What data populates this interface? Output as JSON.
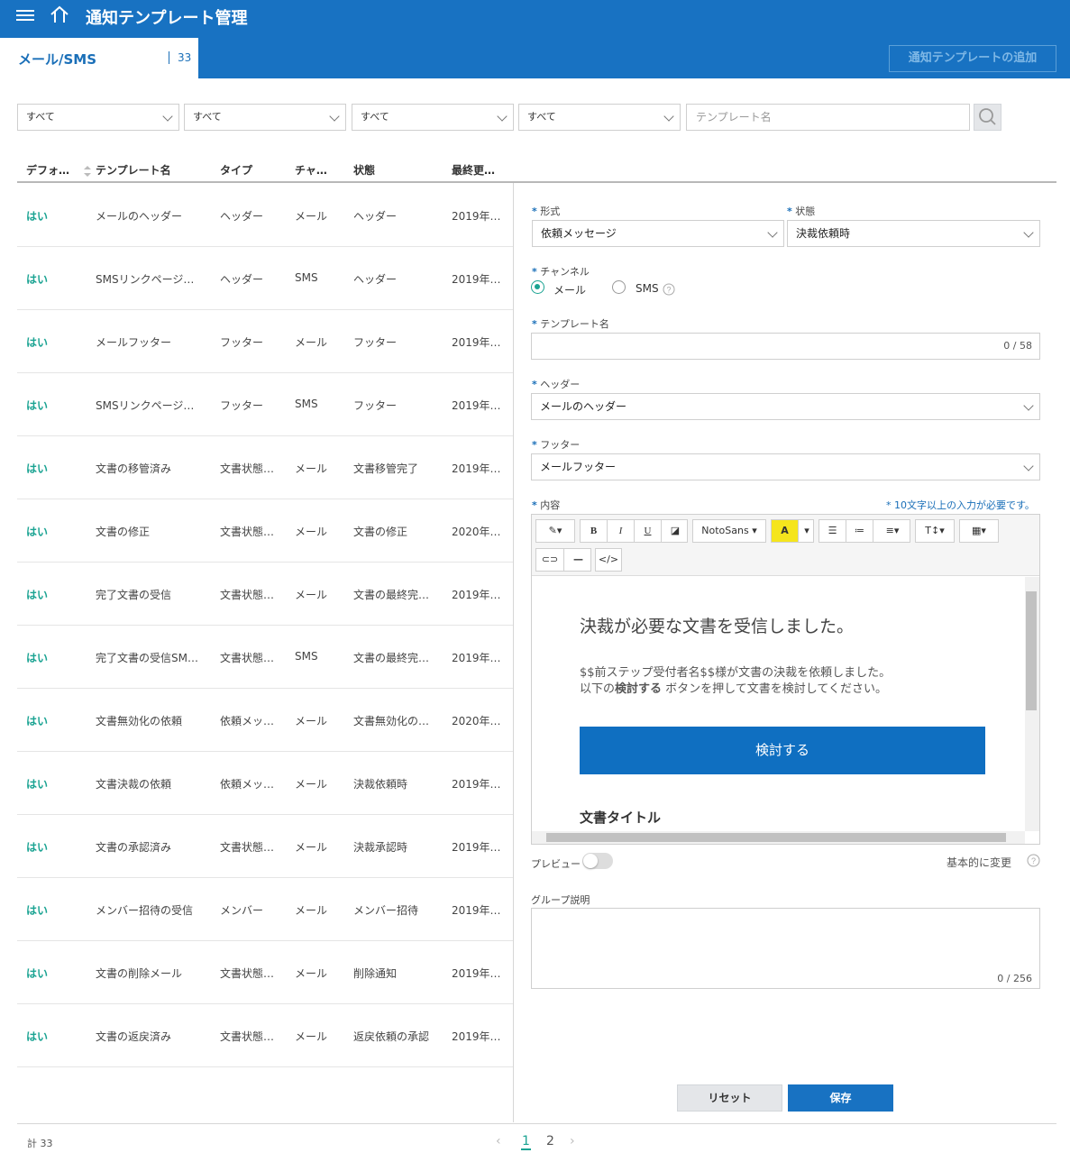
{
  "header": {
    "title": "通知テンプレート管理"
  },
  "tab": {
    "label": "メール/SMS",
    "count": "33"
  },
  "add_button": "通知テンプレートの追加",
  "filters": {
    "f1": "すべて",
    "f2": "すべて",
    "f3": "すべて",
    "f4": "すべて",
    "search_placeholder": "テンプレート名"
  },
  "table": {
    "headers": {
      "default": "デフォ…",
      "name": "テンプレート名",
      "type": "タイプ",
      "channel": "チャ…",
      "status": "状態",
      "updated": "最終更…"
    },
    "rows": [
      {
        "default": "はい",
        "name": "メールのヘッダー",
        "type": "ヘッダー",
        "channel": "メール",
        "status": "ヘッダー",
        "updated": "2019年…"
      },
      {
        "default": "はい",
        "name": "SMSリンクページ…",
        "type": "ヘッダー",
        "channel": "SMS",
        "status": "ヘッダー",
        "updated": "2019年…"
      },
      {
        "default": "はい",
        "name": "メールフッター",
        "type": "フッター",
        "channel": "メール",
        "status": "フッター",
        "updated": "2019年…"
      },
      {
        "default": "はい",
        "name": "SMSリンクページ…",
        "type": "フッター",
        "channel": "SMS",
        "status": "フッター",
        "updated": "2019年…"
      },
      {
        "default": "はい",
        "name": "文書の移管済み",
        "type": "文書状態…",
        "channel": "メール",
        "status": "文書移管完了",
        "updated": "2019年…"
      },
      {
        "default": "はい",
        "name": "文書の修正",
        "type": "文書状態…",
        "channel": "メール",
        "status": "文書の修正",
        "updated": "2020年…"
      },
      {
        "default": "はい",
        "name": "完了文書の受信",
        "type": "文書状態…",
        "channel": "メール",
        "status": "文書の最終完…",
        "updated": "2019年…"
      },
      {
        "default": "はい",
        "name": "完了文書の受信SM…",
        "type": "文書状態…",
        "channel": "SMS",
        "status": "文書の最終完…",
        "updated": "2019年…"
      },
      {
        "default": "はい",
        "name": "文書無効化の依頼",
        "type": "依頼メッ…",
        "channel": "メール",
        "status": "文書無効化の…",
        "updated": "2020年…"
      },
      {
        "default": "はい",
        "name": "文書決裁の依頼",
        "type": "依頼メッ…",
        "channel": "メール",
        "status": "決裁依頼時",
        "updated": "2019年…"
      },
      {
        "default": "はい",
        "name": "文書の承認済み",
        "type": "文書状態…",
        "channel": "メール",
        "status": "決裁承認時",
        "updated": "2019年…"
      },
      {
        "default": "はい",
        "name": "メンバー招待の受信",
        "type": "メンバー",
        "channel": "メール",
        "status": "メンバー招待",
        "updated": "2019年…"
      },
      {
        "default": "はい",
        "name": "文書の削除メール",
        "type": "文書状態…",
        "channel": "メール",
        "status": "削除通知",
        "updated": "2019年…"
      },
      {
        "default": "はい",
        "name": "文書の返戻済み",
        "type": "文書状態…",
        "channel": "メール",
        "status": "返戻依頼の承認",
        "updated": "2019年…"
      }
    ]
  },
  "form": {
    "format_label": "形式",
    "format_value": "依頼メッセージ",
    "status_label": "状態",
    "status_value": "決裁依頼時",
    "channel_label": "チャンネル",
    "channel_mail": "メール",
    "channel_sms": "SMS",
    "name_label": "テンプレート名",
    "name_counter": "0 / 58",
    "header_label": "ヘッダー",
    "header_value": "メールのヘッダー",
    "footer_label": "フッター",
    "footer_value": "メールフッター",
    "content_label": "内容",
    "content_hint": "* 10文字以上の入力が必要です。",
    "font_name": "NotoSans",
    "preview_label": "プレビュー",
    "reset_default": "基本的に変更",
    "group_desc_label": "グループ説明",
    "group_desc_counter": "0 / 256",
    "reset_button": "リセット",
    "save_button": "保存",
    "required_mark": "*"
  },
  "editor_content": {
    "heading": "決裁が必要な文書を受信しました。",
    "line1": "$$前ステップ受付者名$$様が文書の決裁を依頼しました。",
    "line2_pre": "以下の",
    "line2_bold": "検討する",
    "line2_post": " ボタンを押して文書を検討してください。",
    "button": "検討する",
    "doc_title": "文書タイトル"
  },
  "footer": {
    "total": "計 33",
    "pages": [
      "1",
      "2"
    ],
    "current_page": "1"
  },
  "colors": {
    "primary": "#1872c2",
    "accent_green": "#1aa392",
    "editor_button": "#0f6fc1"
  }
}
